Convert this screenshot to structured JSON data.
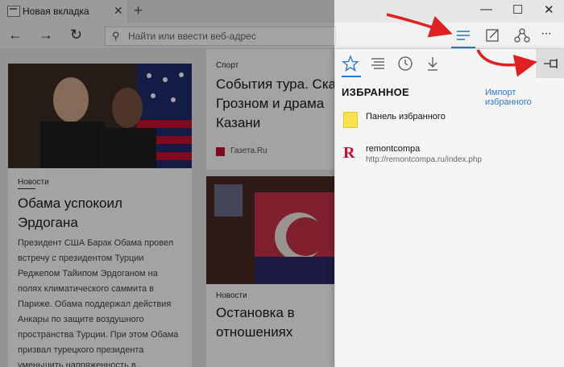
{
  "browser": {
    "tab_title": "Новая вкладка",
    "tab_close": "✕",
    "new_tab": "+",
    "window_controls": {
      "minimize": "—",
      "maximize": "☐",
      "close": "✕"
    },
    "address_placeholder": "Найти или ввести веб-адрес",
    "nav": {
      "back": "←",
      "forward": "→",
      "refresh": "↻"
    },
    "more": "···"
  },
  "feed": {
    "card1": {
      "category": "Новости",
      "headline": "Обама успокоил Эрдогана",
      "body": "Президент США Барак Обама провел встречу с президентом Турции Реджепом Тайипом Эрдоганом на полях климатического саммита в Париже. Обама поддержал действия Анкары по защите воздушного пространства Турции. При этом Обама призвал турецкого президента уменьшить напряженность в..."
    },
    "card2": {
      "category": "Спорт",
      "headline": "События тура. Ска Грозном и драма Казани",
      "source": "Газета.Ru"
    },
    "card3": {
      "category": "Новости",
      "headline": "Остановка в отношениях"
    }
  },
  "hub": {
    "title": "ИЗБРАННОЕ",
    "import_link": "Импорт избранного",
    "items": [
      {
        "name": "Панель избранного",
        "url": ""
      },
      {
        "name": "remontcompa",
        "url": "http://remontcompa.ru/index.php"
      }
    ]
  },
  "colors": {
    "accent": "#2b7ad8",
    "annotation_arrow": "#e02020",
    "folder": "#fce34d"
  }
}
